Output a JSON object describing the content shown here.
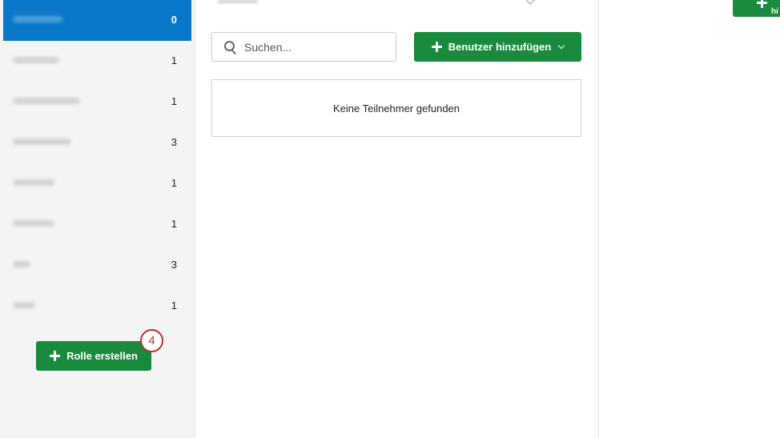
{
  "sidebar": {
    "roles": [
      {
        "count": "0",
        "active": true
      },
      {
        "count": "1",
        "active": false
      },
      {
        "count": "1",
        "active": false
      },
      {
        "count": "3",
        "active": false
      },
      {
        "count": "1",
        "active": false
      },
      {
        "count": "1",
        "active": false
      },
      {
        "count": "3",
        "active": false
      },
      {
        "count": "1",
        "active": false
      }
    ],
    "create_button_label": "Rolle erstellen",
    "callout_number": "4"
  },
  "main": {
    "search_placeholder": "Suchen...",
    "add_user_label": "Benutzer hinzufügen",
    "empty_message": "Keine Teilnehmer gefunden"
  },
  "right_partial": {
    "cut_label": "hi"
  },
  "colors": {
    "accent_blue": "#0a78c8",
    "primary_green": "#1a8a3e",
    "callout_red": "#b1322d"
  },
  "icons": [
    "plus-icon",
    "search-icon",
    "chevron-down-icon"
  ]
}
